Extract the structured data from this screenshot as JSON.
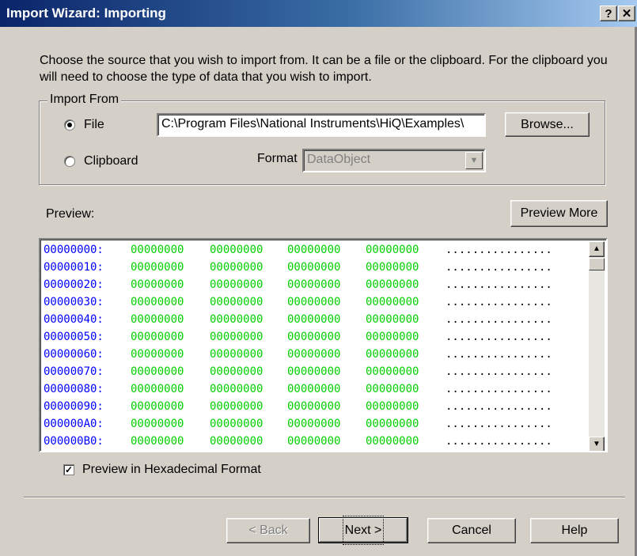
{
  "window": {
    "title": "Import Wizard: Importing",
    "help_glyph": "?",
    "close_glyph": "✕"
  },
  "description": "Choose the source that you wish to import from. It can be a file or the clipboard. For the clipboard you will need to choose the type of data that you wish to import.",
  "import_from": {
    "legend": "Import From",
    "file_label": "File",
    "file_selected": true,
    "clipboard_label": "Clipboard",
    "path_value": "C:\\Program Files\\National Instruments\\HiQ\\Examples\\",
    "browse_label": "Browse...",
    "format_label": "Format",
    "format_value": "DataObject"
  },
  "preview": {
    "label": "Preview:",
    "preview_more_label": "Preview More",
    "rows": [
      {
        "addr": "00000000:",
        "bytes": [
          "00000000",
          "00000000",
          "00000000",
          "00000000"
        ],
        "ascii": "................"
      },
      {
        "addr": "00000010:",
        "bytes": [
          "00000000",
          "00000000",
          "00000000",
          "00000000"
        ],
        "ascii": "................"
      },
      {
        "addr": "00000020:",
        "bytes": [
          "00000000",
          "00000000",
          "00000000",
          "00000000"
        ],
        "ascii": "................"
      },
      {
        "addr": "00000030:",
        "bytes": [
          "00000000",
          "00000000",
          "00000000",
          "00000000"
        ],
        "ascii": "................"
      },
      {
        "addr": "00000040:",
        "bytes": [
          "00000000",
          "00000000",
          "00000000",
          "00000000"
        ],
        "ascii": "................"
      },
      {
        "addr": "00000050:",
        "bytes": [
          "00000000",
          "00000000",
          "00000000",
          "00000000"
        ],
        "ascii": "................"
      },
      {
        "addr": "00000060:",
        "bytes": [
          "00000000",
          "00000000",
          "00000000",
          "00000000"
        ],
        "ascii": "................"
      },
      {
        "addr": "00000070:",
        "bytes": [
          "00000000",
          "00000000",
          "00000000",
          "00000000"
        ],
        "ascii": "................"
      },
      {
        "addr": "00000080:",
        "bytes": [
          "00000000",
          "00000000",
          "00000000",
          "00000000"
        ],
        "ascii": "................"
      },
      {
        "addr": "00000090:",
        "bytes": [
          "00000000",
          "00000000",
          "00000000",
          "00000000"
        ],
        "ascii": "................"
      },
      {
        "addr": "000000A0:",
        "bytes": [
          "00000000",
          "00000000",
          "00000000",
          "00000000"
        ],
        "ascii": "................"
      },
      {
        "addr": "000000B0:",
        "bytes": [
          "00000000",
          "00000000",
          "00000000",
          "00000000"
        ],
        "ascii": "................"
      }
    ],
    "hex_checkbox_label": "Preview in Hexadecimal Format",
    "hex_checked": true
  },
  "buttons": {
    "back": "< Back",
    "next": "Next >",
    "cancel": "Cancel",
    "help": "Help"
  },
  "colors": {
    "title_start": "#0a246a",
    "title_end": "#a6caf0",
    "address": "#0000ff",
    "bytes": "#00d000",
    "face": "#d4d0c8"
  }
}
